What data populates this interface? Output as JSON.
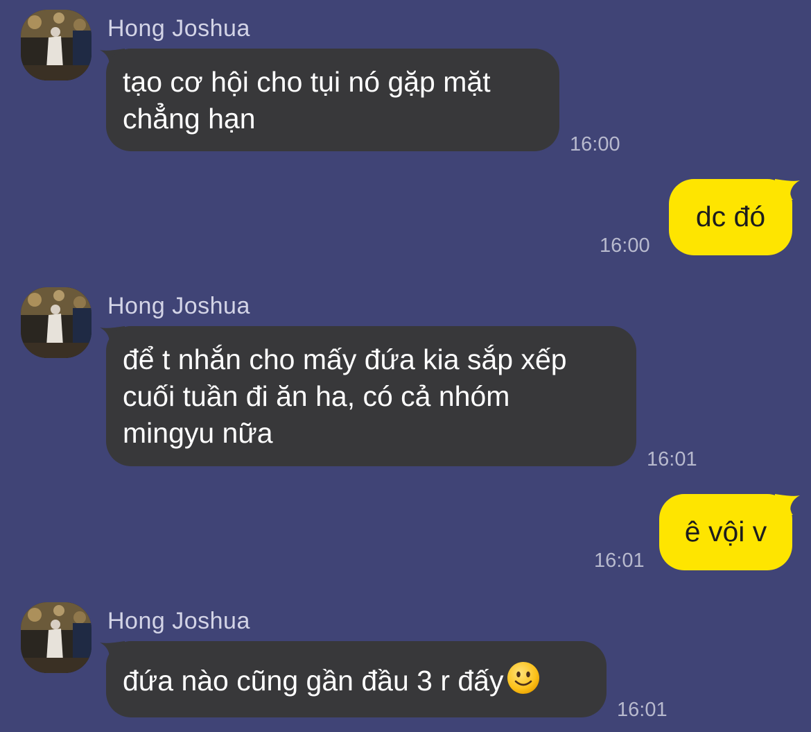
{
  "messages": [
    {
      "sender": "Hong Joshua",
      "lines": [
        "tạo cơ hội cho tụi nó gặp mặt",
        "chẳng hạn"
      ],
      "time": "16:00"
    },
    {
      "outgoing_text": "dc đó",
      "time": "16:00"
    },
    {
      "sender": "Hong Joshua",
      "lines": [
        "để t nhắn cho mấy đứa kia sắp xếp",
        "cuối tuần đi ăn ha, có cả nhóm",
        "mingyu nữa"
      ],
      "time": "16:01"
    },
    {
      "outgoing_text": "ê vội v",
      "time": "16:01"
    },
    {
      "sender": "Hong Joshua",
      "text": "đứa nào cũng gần đầu 3 r đấy",
      "emoji": "slightly-smiling-face-icon",
      "time": "16:01"
    }
  ],
  "colors": {
    "background": "#404476",
    "incoming_bubble": "#38383a",
    "outgoing_bubble": "#fee500",
    "sender_name": "#d3d4e6",
    "timestamp": "#b8bace"
  }
}
